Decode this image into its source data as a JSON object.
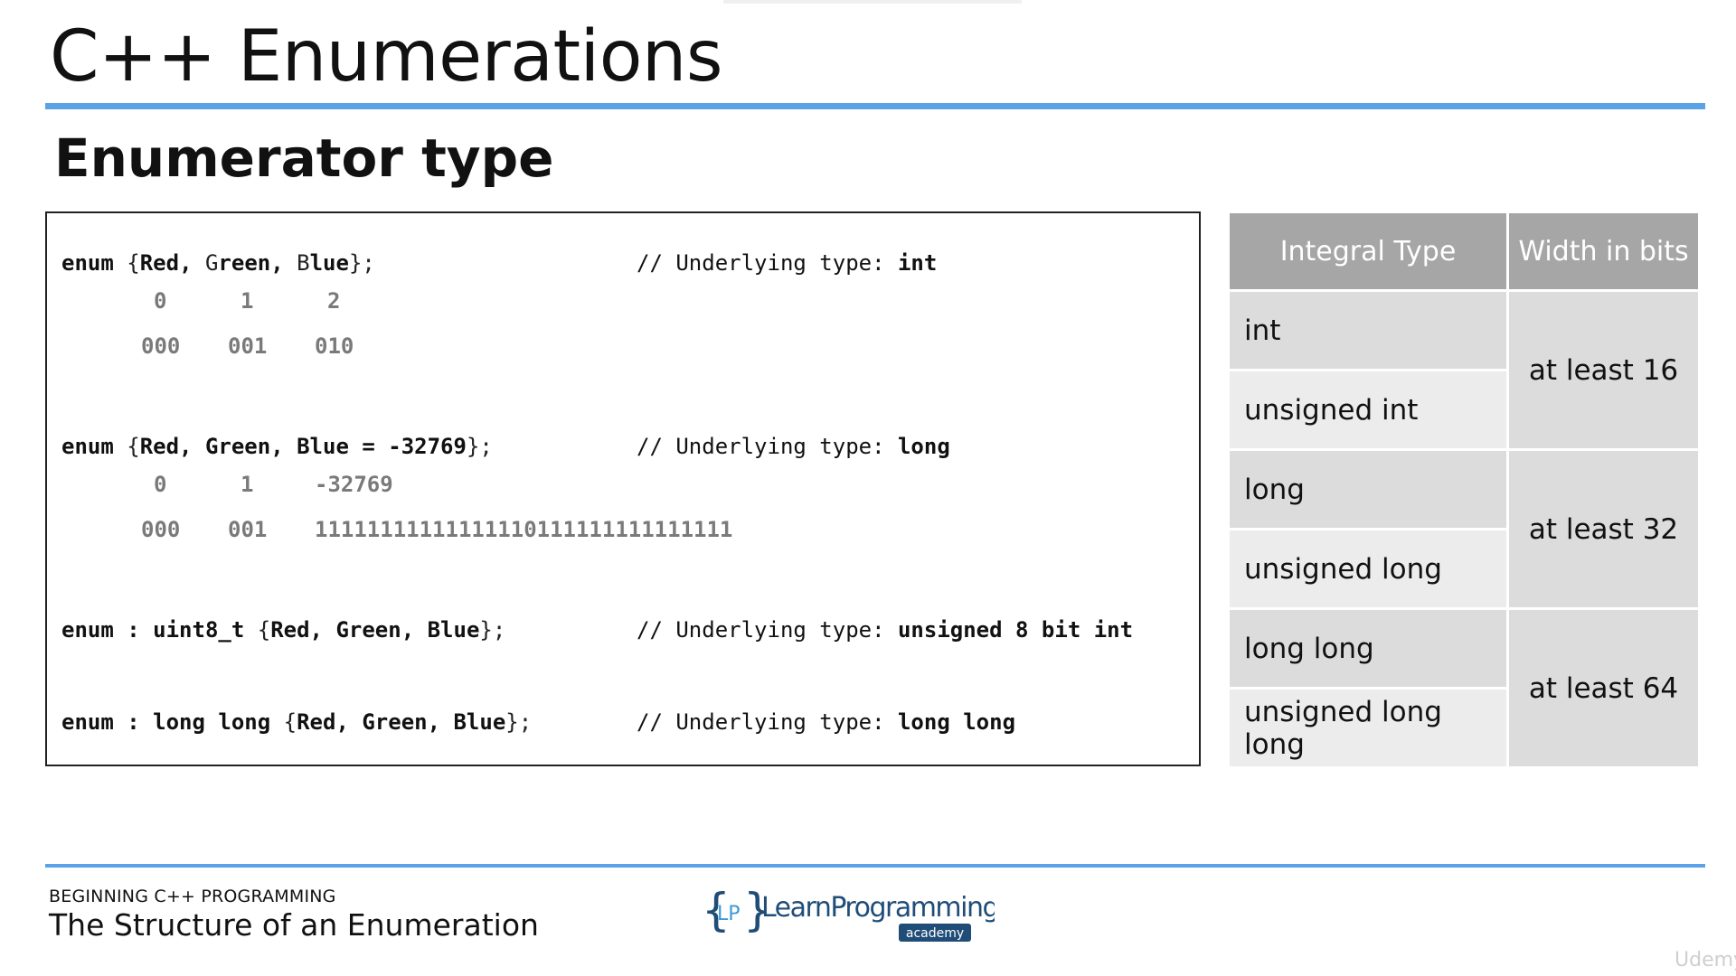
{
  "slide": {
    "title": "C++ Enumerations",
    "subtitle": "Enumerator type"
  },
  "code": {
    "block1": {
      "line": [
        "enum",
        " {",
        "Red",
        ", G",
        "reen",
        ", B",
        "lue",
        "};"
      ],
      "comment_prefix": "// Underlying type: ",
      "comment_type": "int",
      "values": [
        "0",
        "1",
        "2"
      ],
      "bits": [
        "000",
        "001",
        "010"
      ]
    },
    "block2": {
      "line": [
        "enum",
        " {",
        "Red, Green, Blue = -32769",
        "};"
      ],
      "comment_prefix": "// Underlying type: ",
      "comment_type": "long",
      "values": [
        "0",
        "1",
        "-32769"
      ],
      "bits": [
        "000",
        "001",
        "11111111111111110111111111111111"
      ]
    },
    "block3": {
      "line": [
        "enum : uint8_t",
        " {",
        "Red, Green, Blue",
        "};"
      ],
      "comment_prefix": "// Underlying type: ",
      "comment_type": "unsigned 8 bit int"
    },
    "block4": {
      "line": [
        "enum : long long",
        " {",
        "Red, Green, Blue",
        "};"
      ],
      "comment_prefix": "// Underlying type: ",
      "comment_type": "long long"
    }
  },
  "type_table": {
    "headers": [
      "Integral Type",
      "Width in bits"
    ],
    "rows": [
      {
        "types": [
          "int",
          "unsigned int"
        ],
        "width": "at least 16"
      },
      {
        "types": [
          "long",
          "unsigned long"
        ],
        "width": "at least 32"
      },
      {
        "types": [
          "long long",
          "unsigned long long"
        ],
        "width": "at least 64"
      }
    ]
  },
  "footer": {
    "course": "BEGINNING C++ PROGRAMMING",
    "lesson": "The Structure of an Enumeration",
    "logo_text_1": "LearnProgramming",
    "logo_text_2": "academy",
    "logo_brace": "{LP}",
    "watermark": "Udemy"
  },
  "colors": {
    "accent_rule": "#5ba3e6",
    "table_header": "#a6a6a6",
    "table_cell_dark": "#dcdcdc",
    "table_cell_light": "#ececec",
    "code_value_gray": "#7a7a7a",
    "logo_blue": "#3d9ad6",
    "logo_navy": "#1f4d78"
  }
}
